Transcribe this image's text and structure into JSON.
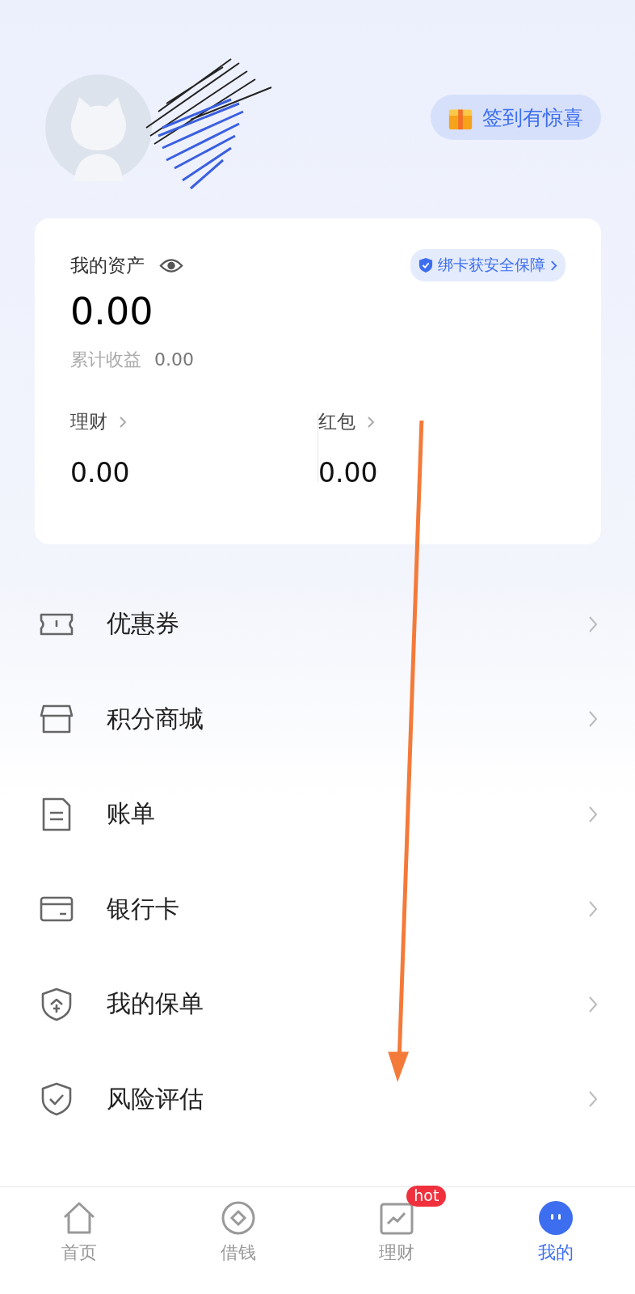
{
  "header": {
    "checkin": "签到有惊喜"
  },
  "assets": {
    "title": "我的资产",
    "badge": "绑卡获安全保障",
    "total": "0.00",
    "earnings_label": "累计收益",
    "earnings": "0.00",
    "items": [
      {
        "label": "理财",
        "value": "0.00"
      },
      {
        "label": "红包",
        "value": "0.00"
      }
    ]
  },
  "menu": [
    {
      "kind": "coupon",
      "label": "优惠券"
    },
    {
      "kind": "mall",
      "label": "积分商城"
    },
    {
      "kind": "bill",
      "label": "账单"
    },
    {
      "kind": "card",
      "label": "银行卡"
    },
    {
      "kind": "policy",
      "label": "我的保单"
    },
    {
      "kind": "risk",
      "label": "风险评估"
    }
  ],
  "tabs": [
    {
      "kind": "home",
      "label": "首页",
      "selected": false
    },
    {
      "kind": "borrow",
      "label": "借钱",
      "selected": false
    },
    {
      "kind": "finance",
      "label": "理财",
      "selected": false,
      "badge": "hot"
    },
    {
      "kind": "mine",
      "label": "我的",
      "selected": true
    }
  ]
}
